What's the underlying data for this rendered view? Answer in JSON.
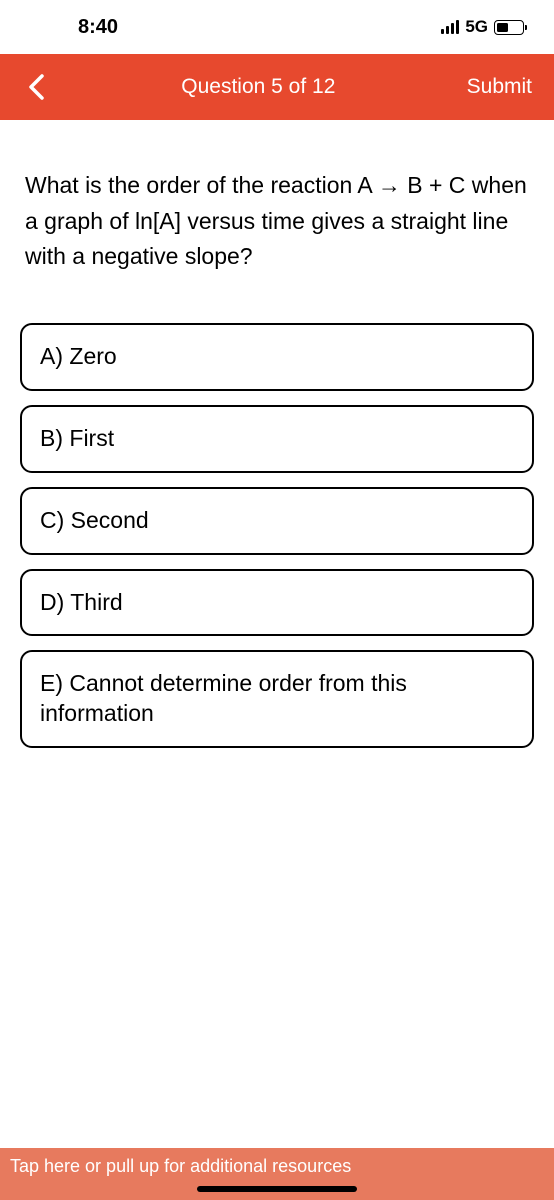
{
  "status_bar": {
    "time": "8:40",
    "network": "5G"
  },
  "header": {
    "counter": "Question 5 of 12",
    "submit": "Submit"
  },
  "question": "What is the order of the reaction A → B + C when a graph of ln[A] versus time gives a straight line with a negative slope?",
  "answers": [
    "A) Zero",
    "B) First",
    "C) Second",
    "D) Third",
    "E) Cannot determine order from this information"
  ],
  "bottom_bar": "Tap here or pull up for additional resources"
}
